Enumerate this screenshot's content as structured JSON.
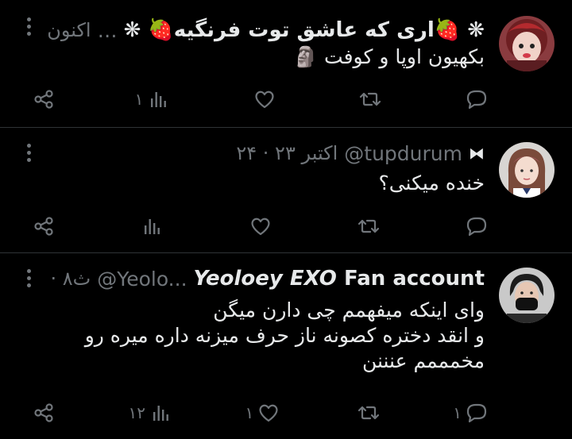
{
  "tweets": [
    {
      "name": "❋ 🍓اری که عاشق توت فرنگیه🍓 ❋",
      "handle": "…",
      "time": "· اکنون",
      "text_lines": [
        "بکهیون اوپا و کوفت 🗿"
      ],
      "counts": {
        "reply": "",
        "retweet": "",
        "like": "",
        "views": "۱"
      }
    },
    {
      "name": "⧓",
      "handle": "@tupdurum",
      "time": "۲۴ · اکتبر ۲۳",
      "text_lines": [
        "خنده میکنی؟"
      ],
      "counts": {
        "reply": "",
        "retweet": "",
        "like": "",
        "views": ""
      }
    },
    {
      "name_bold_italic": "Yeoloey EXO",
      "name_rest": "Fan account",
      "handle": "@Yeolo...",
      "time": "· ۸ث",
      "text_lines": [
        "وای اینکه میفهمم چی دارن میگن",
        "و انقد دختره کصونه ناز حرف میزنه داره میره رو",
        "مخمممم عنننن"
      ],
      "counts": {
        "reply": "۱",
        "retweet": "",
        "like": "۱",
        "views": "۱۲"
      }
    }
  ],
  "icons": [
    "reply-icon",
    "retweet-icon",
    "like-icon",
    "views-icon",
    "share-icon",
    "more-icon"
  ],
  "colors": {
    "background": "#000000",
    "text": "#e7e9ea",
    "muted": "#71767b",
    "divider": "#2f3336"
  }
}
